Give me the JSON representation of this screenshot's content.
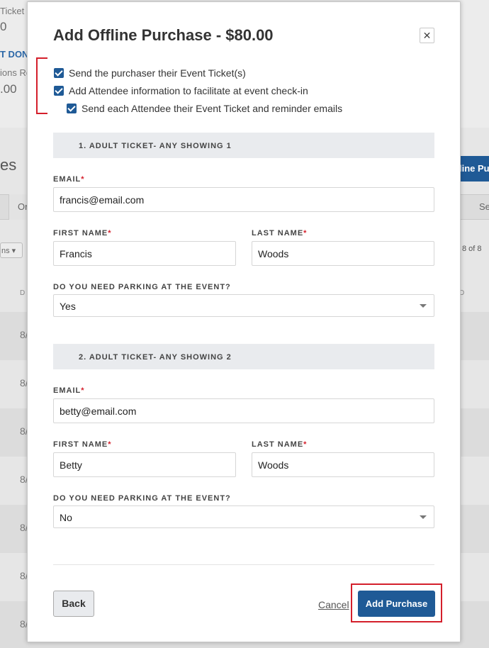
{
  "background": {
    "ticket_label": "Ticket S",
    "ticket_value": "0",
    "donation_link": "T DONA",
    "donations_label": "ions Re",
    "donations_value": ".00",
    "section_title": "es",
    "tab_label": "Or",
    "right_button": "line Pur",
    "right_tab": "Se",
    "filter_button": "ns ▾",
    "page_info": "8 of 8",
    "column_header": "D",
    "column_header_right": "D",
    "row_values": [
      "8/",
      "8/",
      "8/",
      "8/",
      "8/",
      "8/",
      "8/"
    ]
  },
  "modal": {
    "title": "Add Offline Purchase - $80.00",
    "close_icon": "close-icon",
    "options": [
      {
        "label": "Send the purchaser their Event Ticket(s)",
        "checked": true
      },
      {
        "label": "Add Attendee information to facilitate at event check-in",
        "checked": true
      },
      {
        "label": "Send each Attendee their Event Ticket and reminder emails",
        "checked": true
      }
    ],
    "tickets": [
      {
        "heading": "1. ADULT TICKET- ANY SHOWING 1",
        "email_label": "EMAIL",
        "email_value": "francis@email.com",
        "first_name_label": "FIRST NAME",
        "first_name_value": "Francis",
        "last_name_label": "LAST NAME",
        "last_name_value": "Woods",
        "parking_label": "DO YOU NEED PARKING AT THE EVENT?",
        "parking_value": "Yes"
      },
      {
        "heading": "2. ADULT TICKET- ANY SHOWING 2",
        "email_label": "EMAIL",
        "email_value": "betty@email.com",
        "first_name_label": "FIRST NAME",
        "first_name_value": "Betty",
        "last_name_label": "LAST NAME",
        "last_name_value": "Woods",
        "parking_label": "DO YOU NEED PARKING AT THE EVENT?",
        "parking_value": "No"
      }
    ],
    "required_marker": "*",
    "back_label": "Back",
    "cancel_label": "Cancel",
    "submit_label": "Add Purchase"
  },
  "colors": {
    "primary": "#1f5a96",
    "highlight": "#d41f2b",
    "section_bg": "#e9ebee"
  }
}
